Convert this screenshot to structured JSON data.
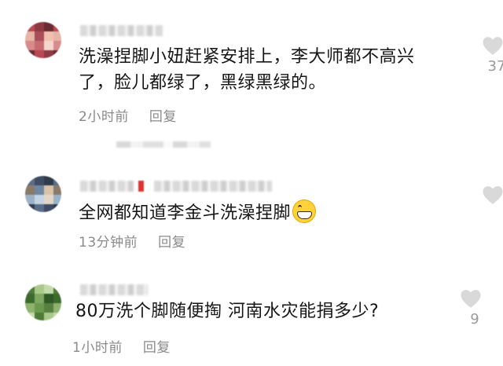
{
  "comments": [
    {
      "text_line1": "洗澡捏脚小妞赶紧安排上，李大师都不高兴",
      "text_line2": "了，脸儿都绿了，黑绿黑绿的。",
      "time": "2小时前",
      "reply": "回复",
      "likes": "37",
      "avatar_colors": [
        "#b84a55",
        "#d98a8a",
        "#f0c0b0",
        "#8e3a44",
        "#c56b70",
        "#e8b4a6",
        "#6a2b33",
        "#f3d7cc",
        "#a94d58"
      ]
    },
    {
      "text": "全网都知道李金斗洗澡捏脚",
      "emoji": "grinning-face-emoji",
      "time": "13分钟前",
      "reply": "回复",
      "likes": "",
      "avatar_colors": [
        "#5a6e8a",
        "#9bb3c8",
        "#d9c2a8",
        "#3e4d63",
        "#c4d4e2",
        "#8a7a6a",
        "#2f3b4c",
        "#e3d6c6",
        "#6f86a0"
      ]
    },
    {
      "text": "80万洗个脚随便掏 河南水灾能捐多少?",
      "time": "1小时前",
      "reply": "回复",
      "likes": "9",
      "avatar_colors": [
        "#4e7a3a",
        "#8fb26e",
        "#2f5a25",
        "#a9c98a",
        "#6b9a4d",
        "#3d6a2d",
        "#c3dba8",
        "#577f42",
        "#7fa862"
      ]
    }
  ],
  "icons": {
    "like": "heart-outline-icon"
  },
  "colors": {
    "text": "#161616",
    "meta": "#8a8a8a",
    "heart": "#cfcfcf"
  }
}
